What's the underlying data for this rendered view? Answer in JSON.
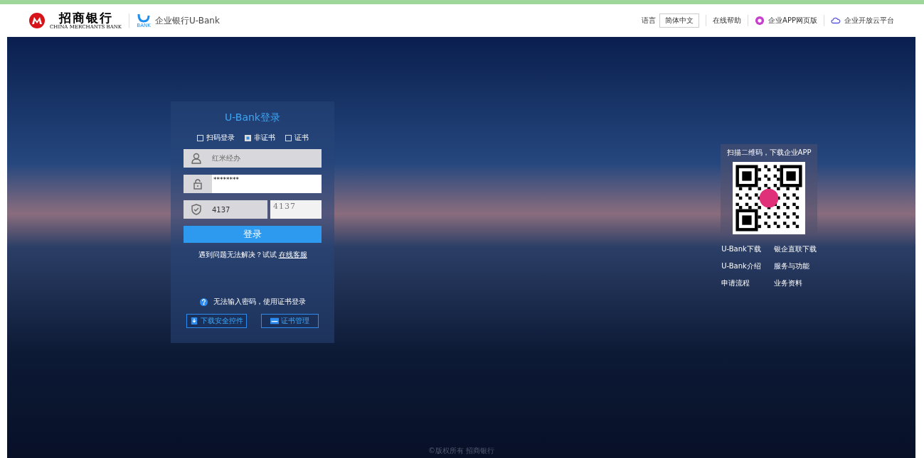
{
  "header": {
    "bank_name": "招商银行",
    "bank_name_en": "CHINA MERCHANTS BANK",
    "ubank_caption": "BANK",
    "product": "企业银行U-Bank",
    "language_label": "语言",
    "language": "简体中文",
    "links": [
      "在线帮助",
      "企业APP网页版",
      "企业开放云平台"
    ]
  },
  "login": {
    "title": "U-Bank登录",
    "modes": [
      {
        "label": "扫码登录",
        "selected": false
      },
      {
        "label": "非证书",
        "selected": true
      },
      {
        "label": "证书",
        "selected": false
      }
    ],
    "username": "红米经办",
    "password": "********",
    "captcha_value": "4137",
    "captcha_image": "4137",
    "submit": "登录",
    "help_text": "遇到问题无法解决？试试",
    "help_link": "在线客服",
    "cert_hint": "无法输入密码，使用证书登录",
    "buttons": [
      "下载安全控件",
      "证书管理"
    ]
  },
  "qr": {
    "caption": "扫描二维码，下载企业APP",
    "links": [
      "U-Bank下载",
      "银企直联下载",
      "U-Bank介绍",
      "服务与功能",
      "申请流程",
      "业务资料"
    ]
  },
  "footer": "©版权所有 招商银行"
}
